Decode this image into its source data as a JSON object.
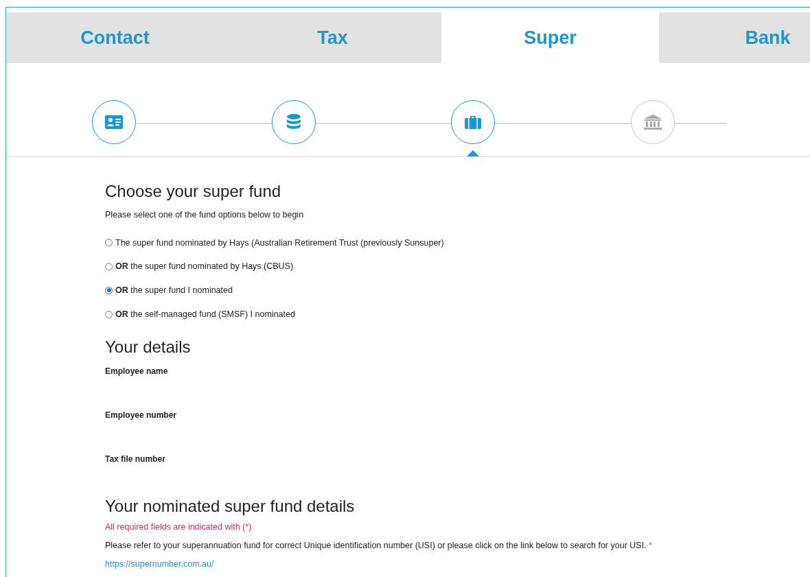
{
  "tabs": [
    {
      "label": "Contact",
      "selected": false
    },
    {
      "label": "Tax",
      "selected": false
    },
    {
      "label": "Super",
      "selected": true
    },
    {
      "label": "Bank",
      "selected": false
    }
  ],
  "steps": [
    {
      "kind": "id-card",
      "reached": true,
      "selected": false
    },
    {
      "kind": "coins",
      "reached": true,
      "selected": false
    },
    {
      "kind": "briefcase",
      "reached": true,
      "selected": true
    },
    {
      "kind": "bank",
      "reached": false,
      "selected": false
    }
  ],
  "fund_choice": {
    "title": "Choose your super fund",
    "intro": "Please select one of the fund options below to begin",
    "options": [
      {
        "label": "The super fund nominated by Hays (Australian Retirement Trust (previously Sunsuper)",
        "selected": false
      },
      {
        "label": "**OR** the super fund nominated by Hays (CBUS)",
        "selected": false
      },
      {
        "label": "**OR** the super fund I nominated",
        "selected": true
      },
      {
        "label": "**OR** the self-managed fund (SMSF) I nominated",
        "selected": false
      }
    ]
  },
  "your_details": {
    "title": "Your details",
    "fields": [
      "Employee name",
      "Employee number",
      "Tax file number"
    ]
  },
  "nominated_fund": {
    "title": "Your nominated super fund details",
    "required_note": "All required fields are indicated with (*)",
    "usi_text": "Please refer to your superannuation fund for correct Unique identification number (USI) or please click on the link below to search for your USI.",
    "usi_required_mark": "*",
    "link": "https://supernumber.com.au/"
  }
}
